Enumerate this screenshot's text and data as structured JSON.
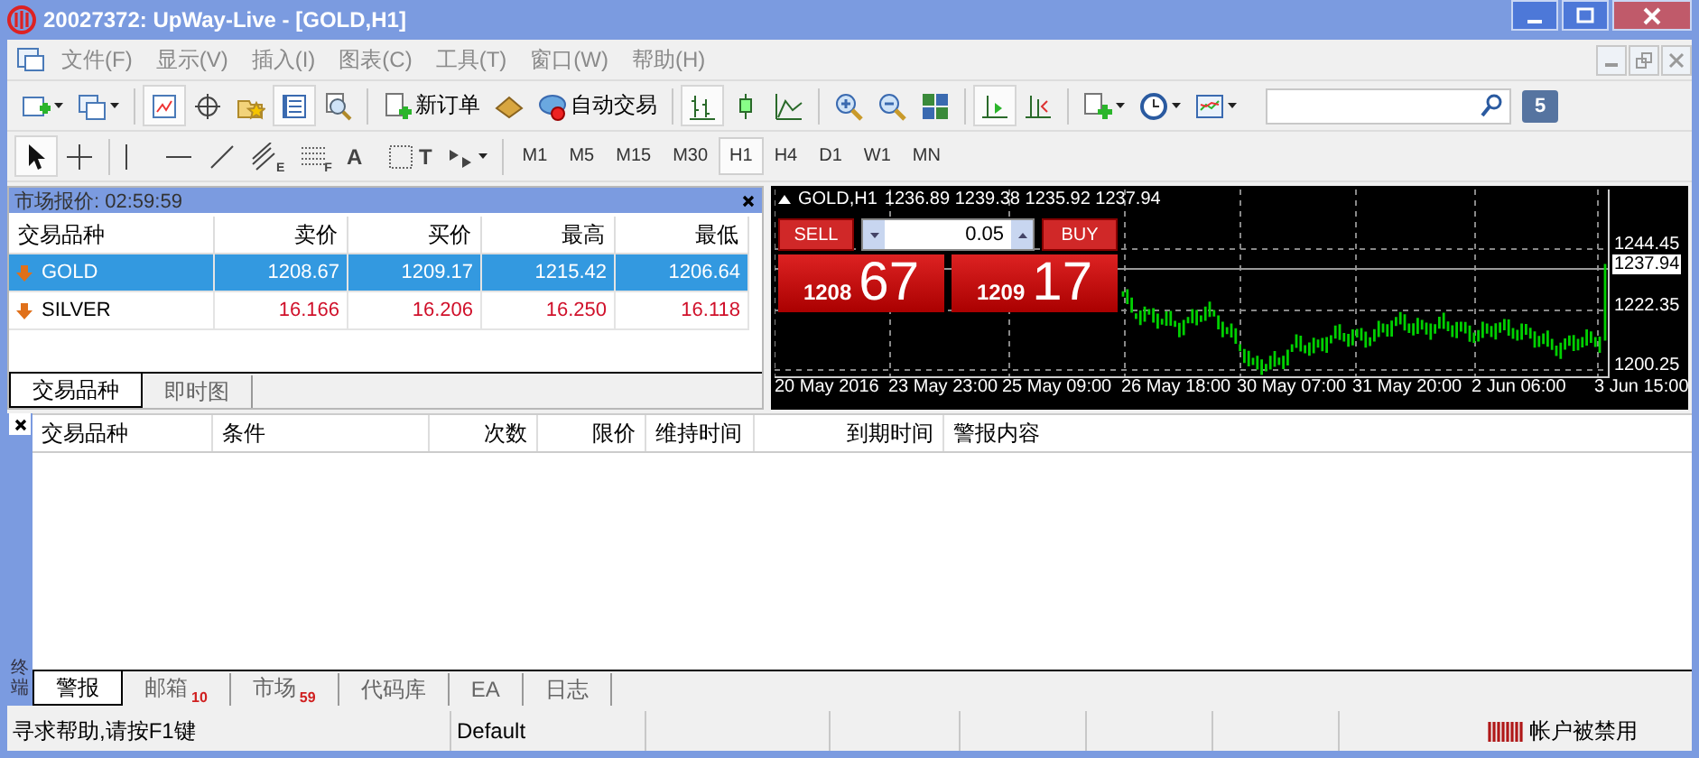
{
  "window": {
    "title": "20027372: UpWay-Live - [GOLD,H1]"
  },
  "menu": [
    "文件(F)",
    "显示(V)",
    "插入(I)",
    "图表(C)",
    "工具(T)",
    "窗口(W)",
    "帮助(H)"
  ],
  "toolbar": [
    {
      "kind": "new-chart",
      "dropdown": true,
      "pressed": false
    },
    {
      "kind": "profiles",
      "dropdown": true,
      "pressed": false
    },
    {
      "kind": "separator"
    },
    {
      "kind": "market-watch",
      "pressed": true
    },
    {
      "kind": "data-window",
      "pressed": false
    },
    {
      "kind": "navigator",
      "pressed": false
    },
    {
      "kind": "terminal",
      "pressed": true
    },
    {
      "kind": "tester",
      "pressed": false
    },
    {
      "kind": "separator"
    },
    {
      "kind": "new-order",
      "label": "新订单",
      "pressed": false
    },
    {
      "kind": "editor",
      "pressed": false
    },
    {
      "kind": "auto-trading",
      "label": "自动交易",
      "pressed": false
    },
    {
      "kind": "separator"
    },
    {
      "kind": "bar-chart",
      "pressed": true
    },
    {
      "kind": "candles",
      "pressed": false
    },
    {
      "kind": "line-chart",
      "pressed": false
    },
    {
      "kind": "separator"
    },
    {
      "kind": "zoom-in",
      "pressed": false
    },
    {
      "kind": "zoom-out",
      "pressed": false
    },
    {
      "kind": "tile",
      "pressed": false
    },
    {
      "kind": "separator"
    },
    {
      "kind": "chart-shift",
      "pressed": true
    },
    {
      "kind": "auto-scroll",
      "pressed": false
    },
    {
      "kind": "separator"
    },
    {
      "kind": "indicators",
      "dropdown": true,
      "pressed": false
    },
    {
      "kind": "periods",
      "dropdown": true,
      "pressed": false
    },
    {
      "kind": "templates",
      "dropdown": true,
      "pressed": false
    }
  ],
  "chat_badge": "5",
  "drawing_tools": [
    {
      "kind": "cursor",
      "pressed": true
    },
    {
      "kind": "crosshair",
      "pressed": false
    },
    {
      "kind": "separator"
    },
    {
      "kind": "vertical-line",
      "pressed": false
    },
    {
      "kind": "horizontal-line",
      "pressed": false
    },
    {
      "kind": "trend-line",
      "pressed": false
    },
    {
      "kind": "fibo-channel",
      "glyph": "E",
      "pressed": false
    },
    {
      "kind": "fibonacci",
      "glyph": "F",
      "pressed": false
    },
    {
      "kind": "text",
      "glyph": "A",
      "pressed": false
    },
    {
      "kind": "label",
      "glyph": "T",
      "pressed": false
    },
    {
      "kind": "shapes",
      "dropdown": true,
      "pressed": false
    }
  ],
  "periods": [
    {
      "label": "M1",
      "selected": false
    },
    {
      "label": "M5",
      "selected": false
    },
    {
      "label": "M15",
      "selected": false
    },
    {
      "label": "M30",
      "selected": false
    },
    {
      "label": "H1",
      "selected": true
    },
    {
      "label": "H4",
      "selected": false
    },
    {
      "label": "D1",
      "selected": false
    },
    {
      "label": "W1",
      "selected": false
    },
    {
      "label": "MN",
      "selected": false
    }
  ],
  "market_watch": {
    "title": "市场报价: 02:59:59",
    "columns": [
      "交易品种",
      "卖价",
      "买价",
      "最高",
      "最低"
    ],
    "rows": [
      {
        "symbol": "GOLD",
        "bid": "1208.67",
        "ask": "1209.17",
        "high": "1215.42",
        "low": "1206.64",
        "selected": true,
        "falling": true
      },
      {
        "symbol": "SILVER",
        "bid": "16.166",
        "ask": "16.206",
        "high": "16.250",
        "low": "16.118",
        "selected": false,
        "falling": true
      }
    ],
    "tabs": [
      {
        "label": "交易品种",
        "selected": true
      },
      {
        "label": "即时图",
        "selected": false
      }
    ]
  },
  "chart": {
    "symbol": "GOLD,H1",
    "ohlc": "1236.89 1239.38 1235.92 1237.94",
    "one_click": {
      "sell_label": "SELL",
      "buy_label": "BUY",
      "lots": "0.05",
      "sell_big": "1208",
      "sell_pips": "67",
      "buy_big": "1209",
      "buy_pips": "17"
    },
    "price_labels": [
      {
        "text": "1244.45",
        "current": false
      },
      {
        "text": "1237.94",
        "current": true
      },
      {
        "text": "1222.35",
        "current": false
      },
      {
        "text": "1200.25",
        "current": false
      }
    ],
    "time_labels": [
      "20 May 2016",
      "23 May 23:00",
      "25 May 09:00",
      "26 May 18:00",
      "30 May 07:00",
      "31 May 20:00",
      "2 Jun 06:00",
      "3 Jun 15:00"
    ]
  },
  "terminal": {
    "side_label": "终端",
    "columns": [
      "交易品种",
      "条件",
      "次数",
      "限价",
      "维持时间",
      "到期时间",
      "警报内容"
    ],
    "tabs": [
      {
        "label": "警报",
        "selected": true
      },
      {
        "label": "邮箱",
        "badge": "10",
        "selected": false
      },
      {
        "label": "市场",
        "badge": "59",
        "selected": false
      },
      {
        "label": "代码库",
        "selected": false
      },
      {
        "label": "EA",
        "selected": false
      },
      {
        "label": "日志",
        "selected": false
      }
    ]
  },
  "status_bar": {
    "help": "寻求帮助,请按F1键",
    "profile": "Default",
    "connection": "帐户被禁用"
  }
}
